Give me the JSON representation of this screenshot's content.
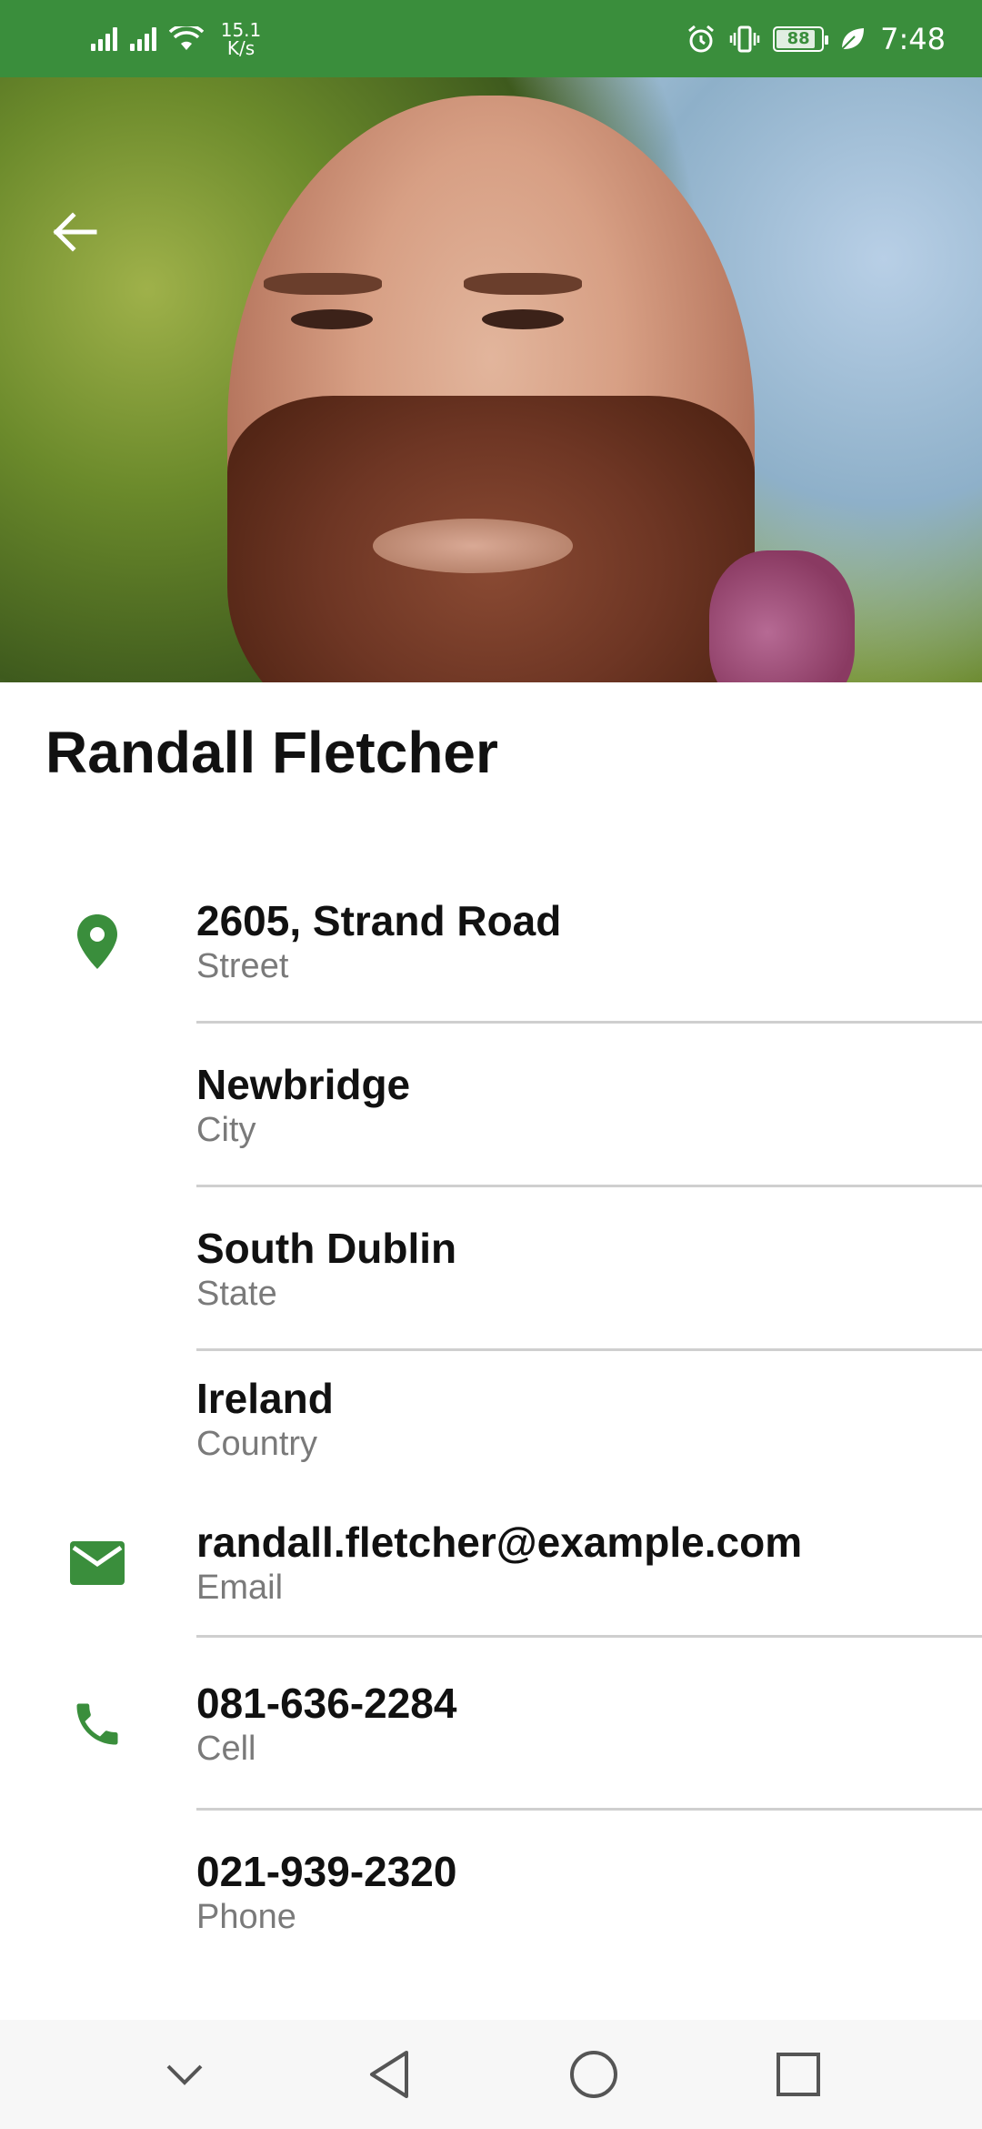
{
  "status_bar": {
    "net_speed_value": "15.1",
    "net_speed_unit": "K/s",
    "battery_level": "88",
    "time": "7:48"
  },
  "contact": {
    "name": "Randall Fletcher",
    "fields": [
      {
        "id": "street",
        "value": "2605, Strand Road",
        "label": "Street",
        "icon": "location-pin-icon"
      },
      {
        "id": "city",
        "value": "Newbridge",
        "label": "City"
      },
      {
        "id": "state",
        "value": "South Dublin",
        "label": "State"
      },
      {
        "id": "country",
        "value": "Ireland",
        "label": "Country"
      },
      {
        "id": "email",
        "value": "randall.fletcher@example.com",
        "label": "Email",
        "icon": "email-icon"
      },
      {
        "id": "cell",
        "value": "081-636-2284",
        "label": "Cell",
        "icon": "phone-icon"
      },
      {
        "id": "phone",
        "value": "021-939-2320",
        "label": "Phone"
      }
    ]
  },
  "colors": {
    "primary": "#3a8e3c",
    "text": "#111111",
    "secondary_text": "#7a7a7a",
    "divider": "#cfcfcf"
  },
  "icons": {
    "back": "arrow-left-icon",
    "nav": [
      "chevron-down-icon",
      "back-triangle-icon",
      "home-circle-icon",
      "recents-square-icon"
    ]
  }
}
